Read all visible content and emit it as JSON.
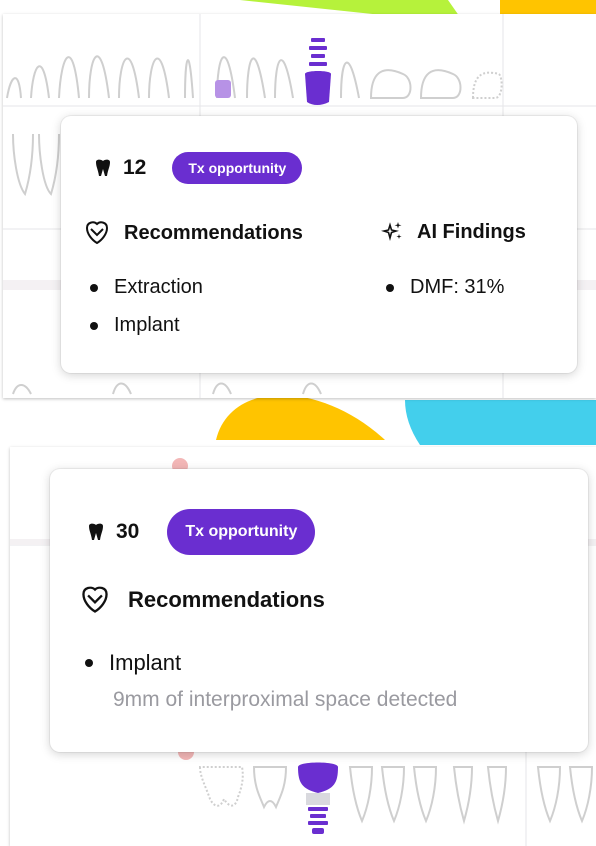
{
  "colors": {
    "brand_purple": "#6a2ed0",
    "accent_green": "#b6f23b",
    "accent_yellow": "#ffc400",
    "accent_cyan": "#43cfec",
    "tooth_outline": "#cfcfcf"
  },
  "card_top": {
    "tooth_icon": "tooth-icon",
    "tooth_number": "12",
    "badge": "Tx opportunity",
    "recommendations": {
      "icon": "tooth-outline-icon",
      "title": "Recommendations",
      "items": [
        "Extraction",
        "Implant"
      ]
    },
    "ai_findings": {
      "icon": "sparkle-icon",
      "title": "AI Findings",
      "items": [
        "DMF: 31%"
      ]
    }
  },
  "card_bottom": {
    "tooth_icon": "tooth-icon",
    "tooth_number": "30",
    "badge": "Tx opportunity",
    "recommendations": {
      "icon": "tooth-outline-icon",
      "title": "Recommendations",
      "items": [
        "Implant"
      ],
      "note": "9mm of interproximal space detected"
    }
  }
}
